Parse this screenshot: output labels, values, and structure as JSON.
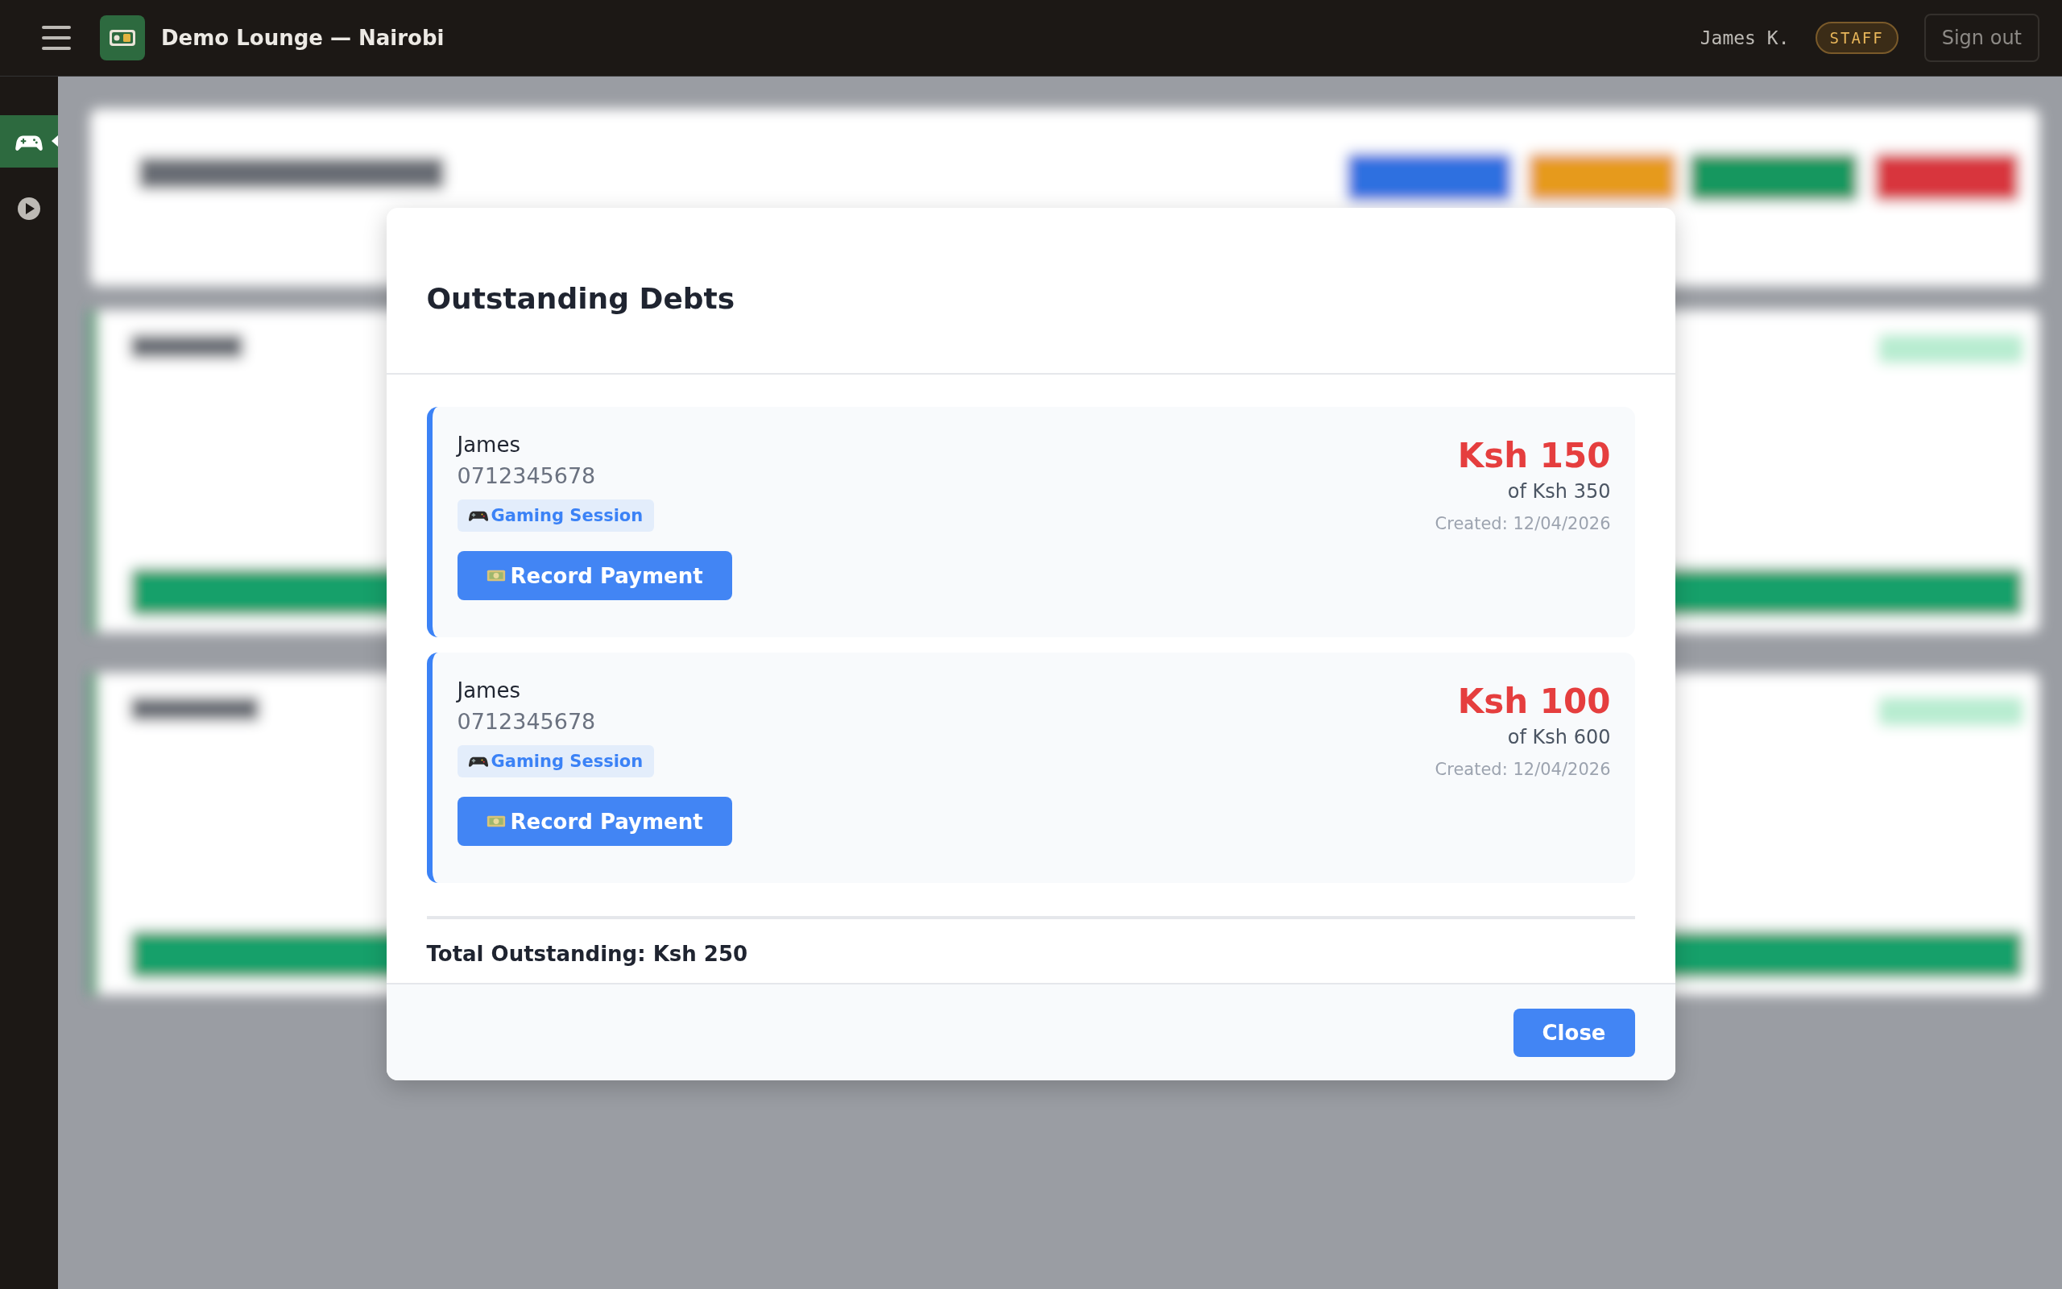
{
  "topbar": {
    "title": "Demo Lounge — Nairobi",
    "user": "James K.",
    "role_badge": "STAFF",
    "sign_out": "Sign out"
  },
  "sidebar": {
    "items": [
      {
        "kind": "gamepad",
        "selected": true
      },
      {
        "kind": "play",
        "selected": false
      }
    ]
  },
  "modal": {
    "title": "Outstanding Debts",
    "debts": [
      {
        "name": "James",
        "phone": "0712345678",
        "tag": "Gaming Session",
        "action": "Record Payment",
        "amount": "Ksh 150",
        "of_total": "of Ksh 350",
        "created": "Created: 12/04/2026"
      },
      {
        "name": "James",
        "phone": "0712345678",
        "tag": "Gaming Session",
        "action": "Record Payment",
        "amount": "Ksh 100",
        "of_total": "of Ksh 600",
        "created": "Created: 12/04/2026"
      }
    ],
    "total": "Total Outstanding: Ksh 250",
    "close": "Close"
  }
}
